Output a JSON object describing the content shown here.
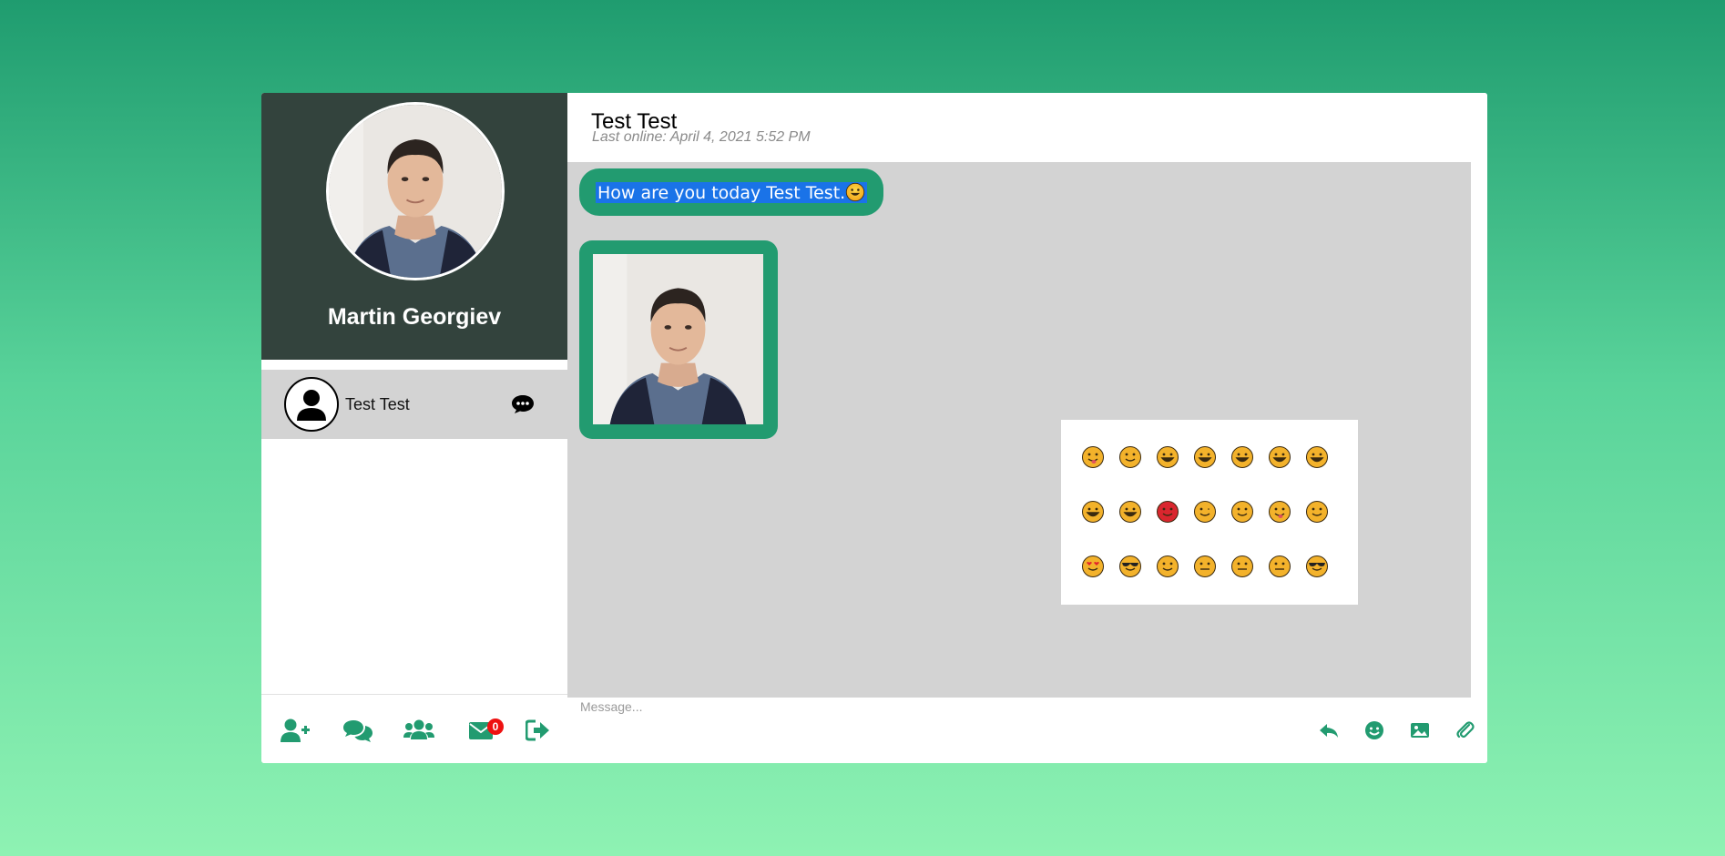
{
  "profile": {
    "name": "Martin Georgiev"
  },
  "contacts": [
    {
      "name": "Test Test"
    }
  ],
  "footer": {
    "unread_count": "0"
  },
  "chat": {
    "title": "Test Test",
    "status": "Last online: April 4, 2021 5:52 PM",
    "messages": [
      {
        "type": "text",
        "text": "How are you today Test Test."
      },
      {
        "type": "image"
      }
    ]
  },
  "composer": {
    "placeholder": "Message..."
  },
  "colors": {
    "accent": "#229b70",
    "sidebar_header": "#33433d",
    "chat_background": "#d3d3d3",
    "badge": "#ee1111",
    "selection": "#1a73e8"
  }
}
